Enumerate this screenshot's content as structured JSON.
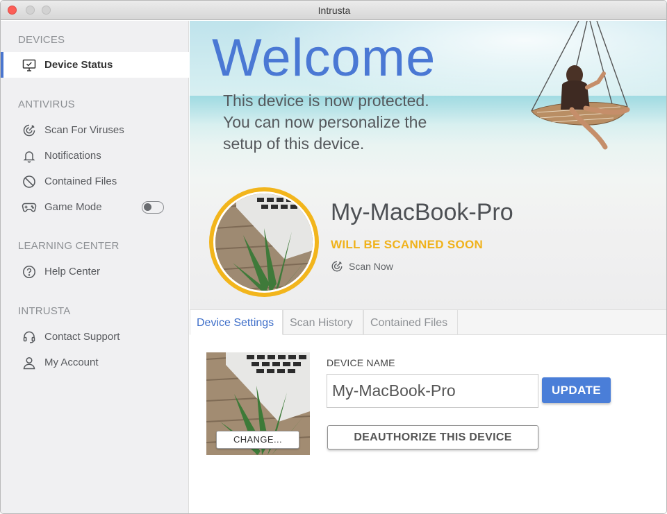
{
  "window": {
    "title": "Intrusta"
  },
  "sidebar": {
    "sections": [
      {
        "heading": "DEVICES",
        "items": [
          {
            "label": "Device Status",
            "icon": "monitor-check-icon",
            "active": true
          }
        ]
      },
      {
        "heading": "ANTIVIRUS",
        "items": [
          {
            "label": "Scan For Viruses",
            "icon": "target-scan-icon"
          },
          {
            "label": "Notifications",
            "icon": "bell-icon"
          },
          {
            "label": "Contained Files",
            "icon": "prohibited-icon"
          },
          {
            "label": "Game Mode",
            "icon": "gamepad-icon",
            "toggle": false
          }
        ]
      },
      {
        "heading": "LEARNING CENTER",
        "items": [
          {
            "label": "Help Center",
            "icon": "question-circle-icon"
          }
        ]
      },
      {
        "heading": "INTRUSTA",
        "items": [
          {
            "label": "Contact Support",
            "icon": "headset-icon"
          },
          {
            "label": "My Account",
            "icon": "user-icon"
          }
        ]
      }
    ]
  },
  "hero": {
    "welcome": "Welcome",
    "tagline_lines": [
      "This device is now protected.",
      "You can now personalize the",
      "setup of this device."
    ],
    "device_name": "My-MacBook-Pro",
    "scan_status": "WILL BE SCANNED SOON",
    "scan_now": "Scan Now"
  },
  "tabs": [
    {
      "label": "Device Settings",
      "active": true
    },
    {
      "label": "Scan History",
      "active": false
    },
    {
      "label": "Contained Files",
      "active": false
    }
  ],
  "settings": {
    "change_label": "CHANGE...",
    "device_name_label": "DEVICE NAME",
    "device_name_value": "My-MacBook-Pro",
    "update_label": "UPDATE",
    "deauthorize_label": "DEAUTHORIZE THIS DEVICE"
  },
  "colors": {
    "accent": "#4a76cf",
    "warning": "#f0b21b",
    "sidebar_bg": "#f0f0f2"
  }
}
